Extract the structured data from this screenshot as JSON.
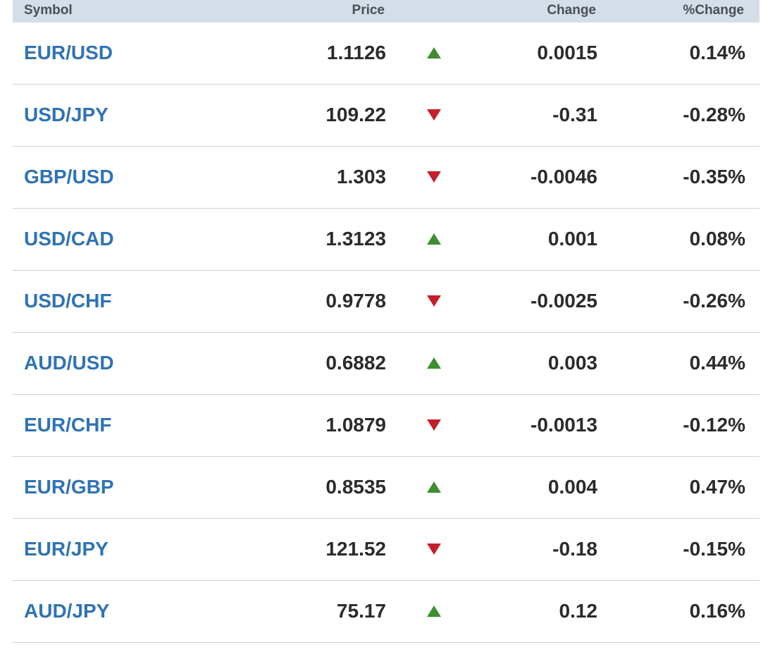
{
  "header": {
    "symbol": "Symbol",
    "price": "Price",
    "change": "Change",
    "pct_change": "%Change"
  },
  "colors": {
    "up": "#3e8e2f",
    "down": "#c41e2b",
    "link": "#2f73b4"
  },
  "rows": [
    {
      "symbol": "EUR/USD",
      "price": "1.1126",
      "direction": "up",
      "change": "0.0015",
      "pct": "0.14%"
    },
    {
      "symbol": "USD/JPY",
      "price": "109.22",
      "direction": "down",
      "change": "-0.31",
      "pct": "-0.28%"
    },
    {
      "symbol": "GBP/USD",
      "price": "1.303",
      "direction": "down",
      "change": "-0.0046",
      "pct": "-0.35%"
    },
    {
      "symbol": "USD/CAD",
      "price": "1.3123",
      "direction": "up",
      "change": "0.001",
      "pct": "0.08%"
    },
    {
      "symbol": "USD/CHF",
      "price": "0.9778",
      "direction": "down",
      "change": "-0.0025",
      "pct": "-0.26%"
    },
    {
      "symbol": "AUD/USD",
      "price": "0.6882",
      "direction": "up",
      "change": "0.003",
      "pct": "0.44%"
    },
    {
      "symbol": "EUR/CHF",
      "price": "1.0879",
      "direction": "down",
      "change": "-0.0013",
      "pct": "-0.12%"
    },
    {
      "symbol": "EUR/GBP",
      "price": "0.8535",
      "direction": "up",
      "change": "0.004",
      "pct": "0.47%"
    },
    {
      "symbol": "EUR/JPY",
      "price": "121.52",
      "direction": "down",
      "change": "-0.18",
      "pct": "-0.15%"
    },
    {
      "symbol": "AUD/JPY",
      "price": "75.17",
      "direction": "up",
      "change": "0.12",
      "pct": "0.16%"
    }
  ]
}
